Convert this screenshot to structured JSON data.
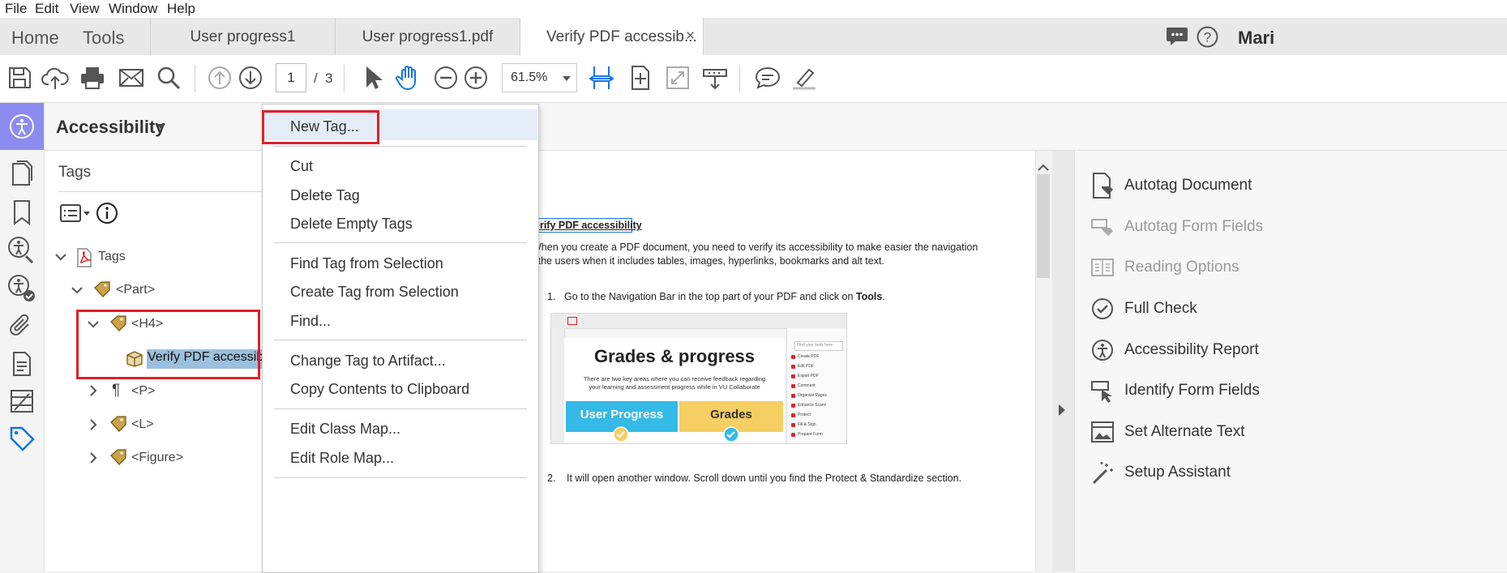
{
  "menubar": {
    "items": [
      "File",
      "Edit",
      "View",
      "Window",
      "Help"
    ]
  },
  "tabs": {
    "home": "Home",
    "tools": "Tools",
    "documents": [
      "User progress1",
      "User progress1.pdf",
      "Verify PDF accessib..."
    ],
    "close_glyph": "×",
    "user_name": "Mari"
  },
  "toolbar": {
    "page_current": "1",
    "page_sep": "/",
    "page_total": "3",
    "zoom": "61.5%",
    "icons": [
      "save-icon",
      "cloud-upload-icon",
      "print-icon",
      "email-icon",
      "search-icon",
      "page-up-icon",
      "page-down-icon",
      "select-arrow-icon",
      "hand-icon",
      "zoom-out-icon",
      "zoom-in-icon",
      "fit-width-icon",
      "fit-page-icon",
      "full-screen-icon",
      "read-mode-icon",
      "comment-icon",
      "highlight-icon"
    ]
  },
  "accessibility_header": {
    "title": "Accessibility"
  },
  "tags_panel": {
    "title": "Tags",
    "tree": {
      "root": "Tags",
      "part": "<Part>",
      "h4": "<H4>",
      "h4_content": "Verify PDF accessibilit",
      "p": "<P>",
      "l": "<L>",
      "figure": "<Figure>"
    }
  },
  "context_menu": {
    "group1": [
      "New Tag..."
    ],
    "group2": [
      "Cut",
      "Delete Tag",
      "Delete Empty Tags"
    ],
    "group3": [
      "Find Tag from Selection",
      "Create Tag from Selection",
      "Find..."
    ],
    "group4": [
      "Change Tag to Artifact...",
      "Copy Contents to Clipboard"
    ],
    "group5": [
      "Edit Class Map...",
      "Edit Role Map..."
    ]
  },
  "document": {
    "heading": "erify PDF accessibility",
    "para1_line1": "When you create a PDF document, you need to verify its accessibility to make easier the navigation",
    "para1_line2": "r the users when it includes tables, images, hyperlinks, bookmarks and alt text.",
    "step1_num": "1.",
    "step1_text": "Go to the Navigation Bar in the top part of your PDF and click on ",
    "step1_bold": "Tools",
    "step1_end": ".",
    "step2_num": "2.",
    "step2_text": "It will open another window. Scroll down until you find the Protect & Standardize section.",
    "thumb": {
      "title": "Grades & progress",
      "subtitle_line1": "There are two key areas where you can receive feedback regarding",
      "subtitle_line2": "your learning and assessment progress while in VU Collaborate",
      "left_box": "User Progress",
      "right_box": "Grades",
      "search_placeholder": "Find your tools here",
      "side_items": [
        "Create PDF",
        "Edit PDF",
        "Export PDF",
        "Comment",
        "Organize Pages",
        "Enhance Scans",
        "Protect",
        "Fill & Sign",
        "Prepare Form"
      ]
    }
  },
  "right_panel": {
    "items": [
      {
        "label": "Autotag Document",
        "icon": "autotag-document-icon",
        "enabled": true
      },
      {
        "label": "Autotag Form Fields",
        "icon": "autotag-form-fields-icon",
        "enabled": false
      },
      {
        "label": "Reading Options",
        "icon": "reading-options-icon",
        "enabled": false
      },
      {
        "label": "Full Check",
        "icon": "full-check-icon",
        "enabled": true
      },
      {
        "label": "Accessibility Report",
        "icon": "accessibility-report-icon",
        "enabled": true
      },
      {
        "label": "Identify Form Fields",
        "icon": "identify-form-fields-icon",
        "enabled": true
      },
      {
        "label": "Set Alternate Text",
        "icon": "set-alternate-text-icon",
        "enabled": true
      },
      {
        "label": "Setup Assistant",
        "icon": "setup-assistant-icon",
        "enabled": true
      }
    ]
  },
  "colors": {
    "accent_blue": "#1473e6",
    "rail_active": "#8c8cf0",
    "highlight_red": "#e0202a",
    "selection": "#9cbfdc",
    "thumb_cyan": "#35b9e6",
    "thumb_yellow": "#f6cf62"
  }
}
